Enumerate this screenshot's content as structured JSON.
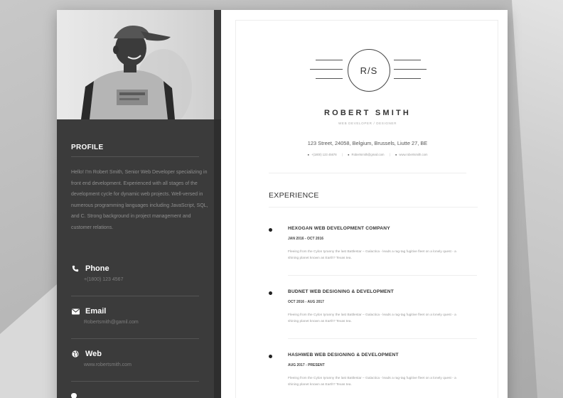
{
  "monogram": "R/S",
  "name": "ROBERT SMITH",
  "role": "WEB DEVELOPER / DESIGNER",
  "address": "123 Street, 24058, Belgium, Brussels, Liutte 27, BE",
  "contact_line": {
    "phone": "+(1800) 123 45678",
    "email": "Robertsmith@gmail.com",
    "web": "www.robertsmith.com"
  },
  "sidebar": {
    "profile_title": "PROFILE",
    "profile_text": "Hello! I'm Robert Smith, Senior Web Developer specializing in front end development. Experienced with all stages of the development cycle for dynamic web projects. Well-versed in numerous programming languages including JavaScript, SQL, and C. Strong background in project management and customer relations.",
    "contacts": [
      {
        "icon": "phone-icon",
        "label": "Phone",
        "value": "+(1800) 123 4567"
      },
      {
        "icon": "envelope-icon",
        "label": "Email",
        "value": "Robertsmith@gamil.com"
      },
      {
        "icon": "globe-icon",
        "label": "Web",
        "value": "www.robertsmith.com"
      }
    ]
  },
  "experience": {
    "title": "EXPERIENCE",
    "jobs": [
      {
        "company": "HEXOGAN WEB DEVELOPMENT COMPANY",
        "dates": "JAN 2016 - OCT 2016",
        "description": "Fleeing from the Cylon tyranny the last Battlestar – Galactica - leads a rag-tag fugitive fleet on a lonely quest - a shining planet known as Earth? Texas tea."
      },
      {
        "company": "BUDNET WEB DESIGNING & DEVELOPMENT",
        "dates": "OCT 2016 - AUG 2017",
        "description": "Fleeing from the Cylon tyranny the last Battlestar – Galactica - leads a rag-tag fugitive fleet on a lonely quest - a shining planet known as Earth? Texas tea."
      },
      {
        "company": "HASHWEB WEB DESIGNING & DEVELOPMENT",
        "dates": "AUG 2017 - PRESENT",
        "description": "Fleeing from the Cylon tyranny the last Battlestar – Galactica - leads a rag-tag fugitive fleet on a lonely quest - a shining planet known as Earth? Texas tea."
      }
    ]
  },
  "colors": {
    "sidebar": "#3b3b3b",
    "page_bg": "#bdbdbd",
    "sheet": "#ffffff",
    "text_dark": "#333333"
  }
}
